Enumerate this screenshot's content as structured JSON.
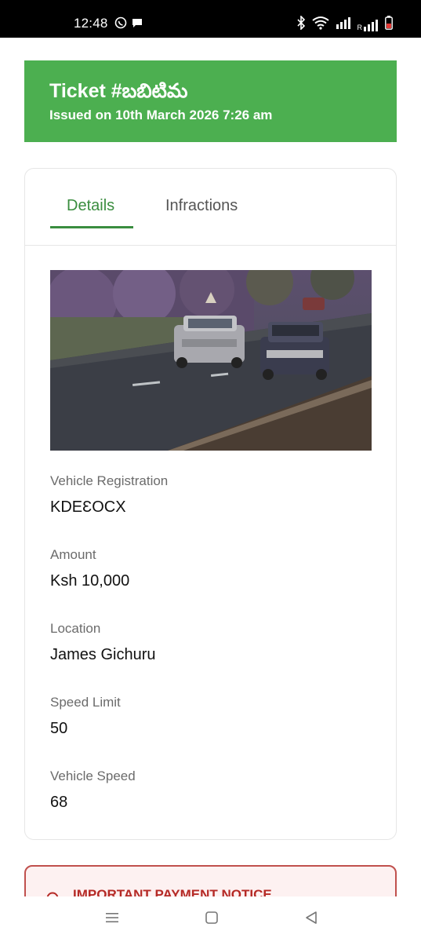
{
  "status_bar": {
    "time": "12:48",
    "left_icons": [
      "whatsapp-icon",
      "message-icon"
    ],
    "right_icons": [
      "bluetooth-icon",
      "wifi-icon",
      "signal-icon",
      "signal-roaming-icon",
      "battery-icon"
    ],
    "roaming_label": "R"
  },
  "ticket": {
    "title": "Ticket #బబిటిమ",
    "issued": "Issued on 10th March 2026 7:26 am"
  },
  "tabs": [
    {
      "label": "Details",
      "active": true
    },
    {
      "label": "Infractions",
      "active": false
    }
  ],
  "details": {
    "vehicle_registration": {
      "label": "Vehicle Registration",
      "value": "KDEƐOCX"
    },
    "amount": {
      "label": "Amount",
      "value": "Ksh 10,000"
    },
    "location": {
      "label": "Location",
      "value": "James Gichuru"
    },
    "speed_limit": {
      "label": "Speed Limit",
      "value": "50"
    },
    "vehicle_speed": {
      "label": "Vehicle Speed",
      "value": "68"
    }
  },
  "notice": {
    "title": "IMPORTANT PAYMENT NOTICE"
  },
  "colors": {
    "header_green": "#4caf50",
    "accent_green": "#3a8d3f",
    "notice_red": "#b52a26",
    "notice_border": "#c0504d"
  },
  "nav_bar": {
    "buttons": [
      "recents-icon",
      "home-icon",
      "back-icon"
    ]
  }
}
